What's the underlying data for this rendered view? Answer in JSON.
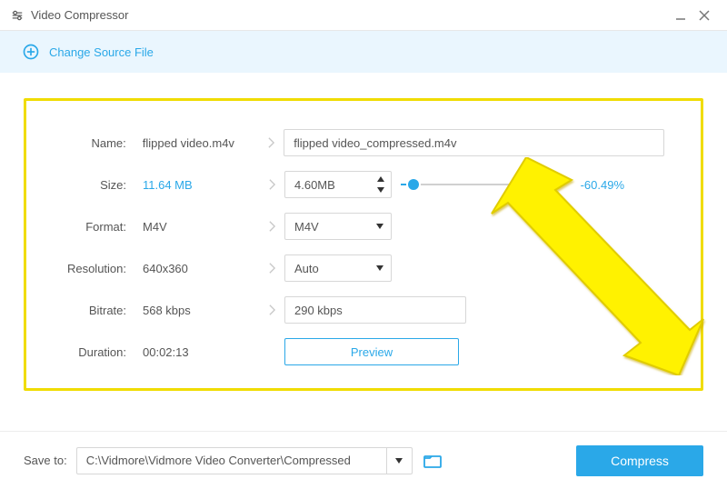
{
  "app": {
    "title": "Video Compressor"
  },
  "changebar": {
    "link": "Change Source File"
  },
  "labels": {
    "name": "Name:",
    "size": "Size:",
    "format": "Format:",
    "resolution": "Resolution:",
    "bitrate": "Bitrate:",
    "duration": "Duration:"
  },
  "source": {
    "name": "flipped video.m4v",
    "size": "11.64 MB",
    "format": "M4V",
    "resolution": "640x360",
    "bitrate": "568 kbps",
    "duration": "00:02:13"
  },
  "target": {
    "name": "flipped video_compressed.m4v",
    "size": "4.60MB",
    "format": "M4V",
    "resolution": "Auto",
    "bitrate": "290 kbps"
  },
  "compression": {
    "percent": "-60.49%",
    "slider_pct": 8
  },
  "buttons": {
    "preview": "Preview",
    "compress": "Compress"
  },
  "footer": {
    "save_label": "Save to:",
    "path": "C:\\Vidmore\\Vidmore Video Converter\\Compressed"
  },
  "colors": {
    "accent": "#2aa8e8",
    "highlight_border": "#f0dc00"
  }
}
